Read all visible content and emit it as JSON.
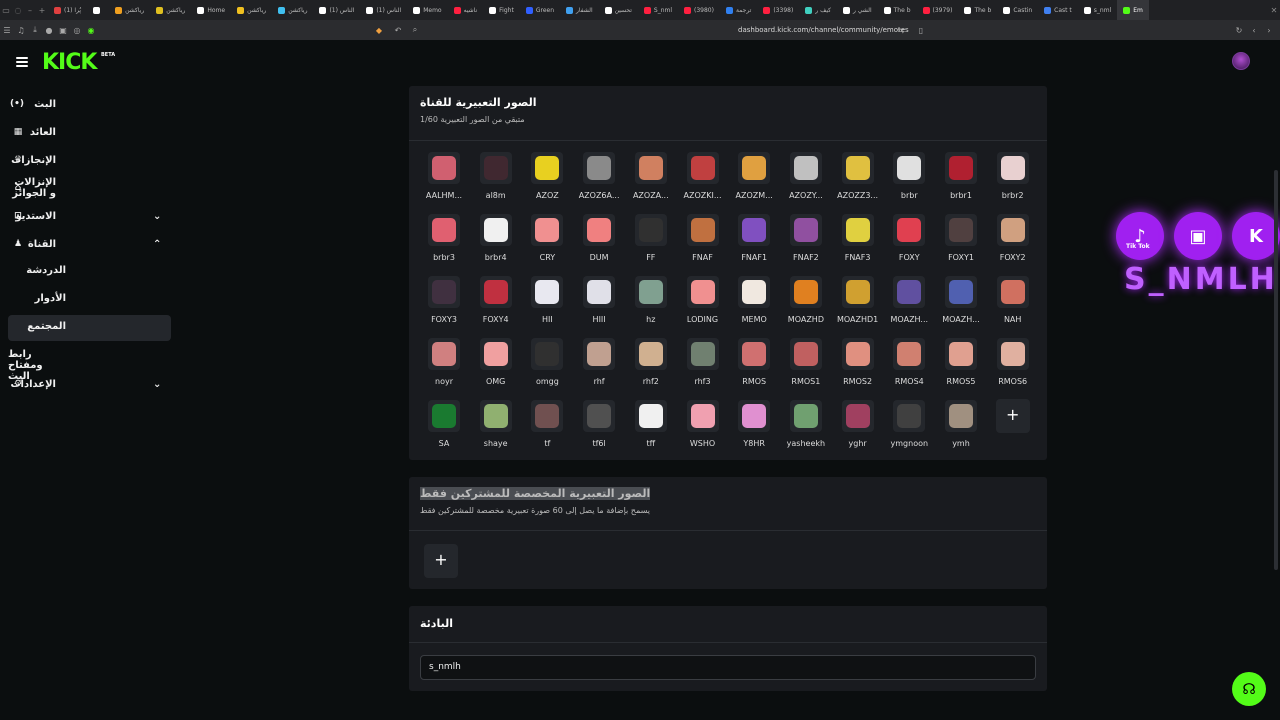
{
  "browser": {
    "tabs": [
      {
        "label": "(1) پُرا",
        "color": "#e04040"
      },
      {
        "label": "",
        "color": "#ffffff"
      },
      {
        "label": "رياكشن",
        "color": "#f0a020"
      },
      {
        "label": "رياكشن",
        "color": "#e0c020"
      },
      {
        "label": "Home",
        "color": "#ffffff"
      },
      {
        "label": "رياكشن",
        "color": "#f0c020"
      },
      {
        "label": "رياكشن",
        "color": "#40c0f0"
      },
      {
        "label": "(1) الناس",
        "color": "#ffffff"
      },
      {
        "label": "(1) الناس",
        "color": "#ffffff"
      },
      {
        "label": "Memo",
        "color": "#ffffff"
      },
      {
        "label": "ناشيه",
        "color": "#ff2040"
      },
      {
        "label": "Fight",
        "color": "#ffffff"
      },
      {
        "label": "Green",
        "color": "#3060ff"
      },
      {
        "label": "الشفار",
        "color": "#40a0f0"
      },
      {
        "label": "تحسين",
        "color": "#ffffff"
      },
      {
        "label": "S_nml",
        "color": "#ff2040"
      },
      {
        "label": "(3980)",
        "color": "#ff2040"
      },
      {
        "label": "ترجمة",
        "color": "#3080f0"
      },
      {
        "label": "(3398)",
        "color": "#ff2040"
      },
      {
        "label": "كيف ر",
        "color": "#40d0c0"
      },
      {
        "label": "الشي ر",
        "color": "#ffffff"
      },
      {
        "label": "The b",
        "color": "#ffffff"
      },
      {
        "label": "(3979)",
        "color": "#ff2040"
      },
      {
        "label": "The b",
        "color": "#ffffff"
      },
      {
        "label": "Castin",
        "color": "#ffffff"
      },
      {
        "label": "Cast t",
        "color": "#4080f0"
      },
      {
        "label": "s_nml",
        "color": "#ffffff"
      },
      {
        "label": "Em",
        "color": "#53fc18"
      }
    ],
    "url": "dashboard.kick.com/channel/community/emotes"
  },
  "header": {
    "logo": "KICK",
    "beta": "BETA"
  },
  "sidebar": {
    "items": [
      {
        "label": "البث",
        "icon": "broadcast-icon",
        "glyph": "(•)"
      },
      {
        "label": "العائد",
        "icon": "revenue-icon",
        "glyph": "▦"
      },
      {
        "label": "الإنجازات",
        "icon": "trophy-icon",
        "glyph": "♛"
      },
      {
        "label": "الإنزالات و الجوائز",
        "icon": "gift-icon",
        "glyph": "⌂"
      },
      {
        "label": "الاستديو",
        "icon": "studio-icon",
        "glyph": "⊡",
        "chevron": "⌄"
      },
      {
        "label": "القناة",
        "icon": "channel-icon",
        "glyph": "♟",
        "chevron": "⌃"
      },
      {
        "label": "الإعدادات",
        "icon": "gear-icon",
        "glyph": "⚙",
        "chevron": "⌄"
      }
    ],
    "sub_items": [
      {
        "label": "الدردشة"
      },
      {
        "label": "الأدوار"
      },
      {
        "label": "المجتمع"
      },
      {
        "label": "رابط ومفتاح البث"
      }
    ]
  },
  "channel_emotes": {
    "title": "الصور التعبيرية للقناة",
    "subtitle": "متبقي من الصور التعبيرية 1/60",
    "emotes": [
      {
        "name": "AALHM...",
        "color": "#d06070"
      },
      {
        "name": "al8m",
        "color": "#402830"
      },
      {
        "name": "AZOZ",
        "color": "#e8d020"
      },
      {
        "name": "AZOZ6A...",
        "color": "#8a8a8a"
      },
      {
        "name": "AZOZA...",
        "color": "#d08060"
      },
      {
        "name": "AZOZKI...",
        "color": "#c04040"
      },
      {
        "name": "AZOZM...",
        "color": "#e0a040"
      },
      {
        "name": "AZOZY...",
        "color": "#c0c0c0"
      },
      {
        "name": "AZOZZ3...",
        "color": "#e0c040"
      },
      {
        "name": "brbr",
        "color": "#e0e0e0"
      },
      {
        "name": "brbr1",
        "color": "#b02030"
      },
      {
        "name": "brbr2",
        "color": "#e8d0d0"
      },
      {
        "name": "brbr3",
        "color": "#e06070"
      },
      {
        "name": "brbr4",
        "color": "#f0f0f0"
      },
      {
        "name": "CRY",
        "color": "#f09090"
      },
      {
        "name": "DUM",
        "color": "#f08080"
      },
      {
        "name": "FF",
        "color": "#303030"
      },
      {
        "name": "FNAF",
        "color": "#c07040"
      },
      {
        "name": "FNAF1",
        "color": "#8050c0"
      },
      {
        "name": "FNAF2",
        "color": "#9050a0"
      },
      {
        "name": "FNAF3",
        "color": "#e0d040"
      },
      {
        "name": "FOXY",
        "color": "#e04050"
      },
      {
        "name": "FOXY1",
        "color": "#504040"
      },
      {
        "name": "FOXY2",
        "color": "#d0a080"
      },
      {
        "name": "FOXY3",
        "color": "#403040"
      },
      {
        "name": "FOXY4",
        "color": "#c03040"
      },
      {
        "name": "HII",
        "color": "#e8e8f0"
      },
      {
        "name": "HIII",
        "color": "#e0e0e8"
      },
      {
        "name": "hz",
        "color": "#80a090"
      },
      {
        "name": "LODING",
        "color": "#f09090"
      },
      {
        "name": "MEMO",
        "color": "#f0e8e0"
      },
      {
        "name": "MOAZHD",
        "color": "#e08020"
      },
      {
        "name": "MOAZHD1",
        "color": "#d0a030"
      },
      {
        "name": "MOAZH...",
        "color": "#6050a0"
      },
      {
        "name": "MOAZH...",
        "color": "#5060b0"
      },
      {
        "name": "NAH",
        "color": "#d07060"
      },
      {
        "name": "noyr",
        "color": "#d08080"
      },
      {
        "name": "OMG",
        "color": "#f0a0a0"
      },
      {
        "name": "omgg",
        "color": "#303030"
      },
      {
        "name": "rhf",
        "color": "#c0a090"
      },
      {
        "name": "rhf2",
        "color": "#d0b090"
      },
      {
        "name": "rhf3",
        "color": "#708070"
      },
      {
        "name": "RMOS",
        "color": "#d07070"
      },
      {
        "name": "RMOS1",
        "color": "#c06060"
      },
      {
        "name": "RMOS2",
        "color": "#e09080"
      },
      {
        "name": "RMOS4",
        "color": "#d08070"
      },
      {
        "name": "RMOS5",
        "color": "#e0a090"
      },
      {
        "name": "RMOS6",
        "color": "#e0b0a0"
      },
      {
        "name": "SA",
        "color": "#1a7a30"
      },
      {
        "name": "shaye",
        "color": "#90b070"
      },
      {
        "name": "tf",
        "color": "#705050"
      },
      {
        "name": "tf6l",
        "color": "#505050"
      },
      {
        "name": "tff",
        "color": "#f0f0f0"
      },
      {
        "name": "WSHO",
        "color": "#f0a0b0"
      },
      {
        "name": "Y8HR",
        "color": "#e090d0"
      },
      {
        "name": "yasheekh",
        "color": "#70a070"
      },
      {
        "name": "yghr",
        "color": "#a04060"
      },
      {
        "name": "ymgnoon",
        "color": "#404040"
      },
      {
        "name": "ymh",
        "color": "#a09080"
      }
    ],
    "add_label": "+"
  },
  "subscriber_emotes": {
    "title": "الصور التعبيرية المخصصة للمشتركين فقط",
    "subtitle": "يسمح بإضافة ما يصل إلى 60 صورة تعبيرية مخصصة للمشتركين فقط",
    "add_label": "+"
  },
  "prefix": {
    "title": "البادئة",
    "value": "s_nmlh"
  },
  "overlay": {
    "icons": [
      {
        "name": "tiktok-icon",
        "glyph": "♪",
        "label": "Tik Tok"
      },
      {
        "name": "twitch-icon",
        "glyph": "▣"
      },
      {
        "name": "kick-icon",
        "glyph": "K"
      }
    ],
    "text": "S_NMLH"
  },
  "support": {
    "glyph": "☊"
  },
  "colors": {
    "accent": "#53fc18",
    "panel": "#191b1f",
    "background": "#0b0e0f"
  }
}
